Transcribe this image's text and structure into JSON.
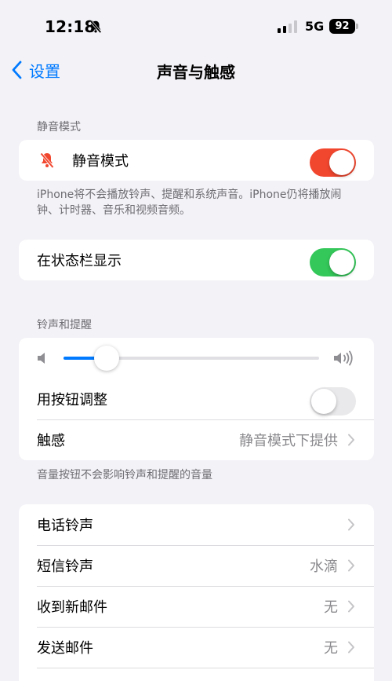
{
  "status_bar": {
    "time": "12:18",
    "network": "5G",
    "battery": "92"
  },
  "nav": {
    "back_label": "设置",
    "title": "声音与触感"
  },
  "silent_section": {
    "header": "静音模式",
    "silent_label": "静音模式",
    "silent_on": true,
    "footer": "iPhone将不会播放铃声、提醒和系统声音。iPhone仍将播放闹钟、计时器、音乐和视频音频。"
  },
  "status_bar_section": {
    "label": "在状态栏显示",
    "on": true
  },
  "ringer_section": {
    "header": "铃声和提醒",
    "volume_level": 0.17,
    "buttons_label": "用按钮调整",
    "buttons_on": false,
    "haptics_label": "触感",
    "haptics_value": "静音模式下提供",
    "footer": "音量按钮不会影响铃声和提醒的音量"
  },
  "tones": [
    {
      "label": "电话铃声",
      "value": ""
    },
    {
      "label": "短信铃声",
      "value": "水滴"
    },
    {
      "label": "收到新邮件",
      "value": "无"
    },
    {
      "label": "发送邮件",
      "value": "无"
    }
  ],
  "colors": {
    "accent": "#007aff",
    "silent_toggle": "#f2472f",
    "green_toggle": "#34c759",
    "off_toggle": "#e9e9eb",
    "bell_icon": "#f2472f"
  }
}
